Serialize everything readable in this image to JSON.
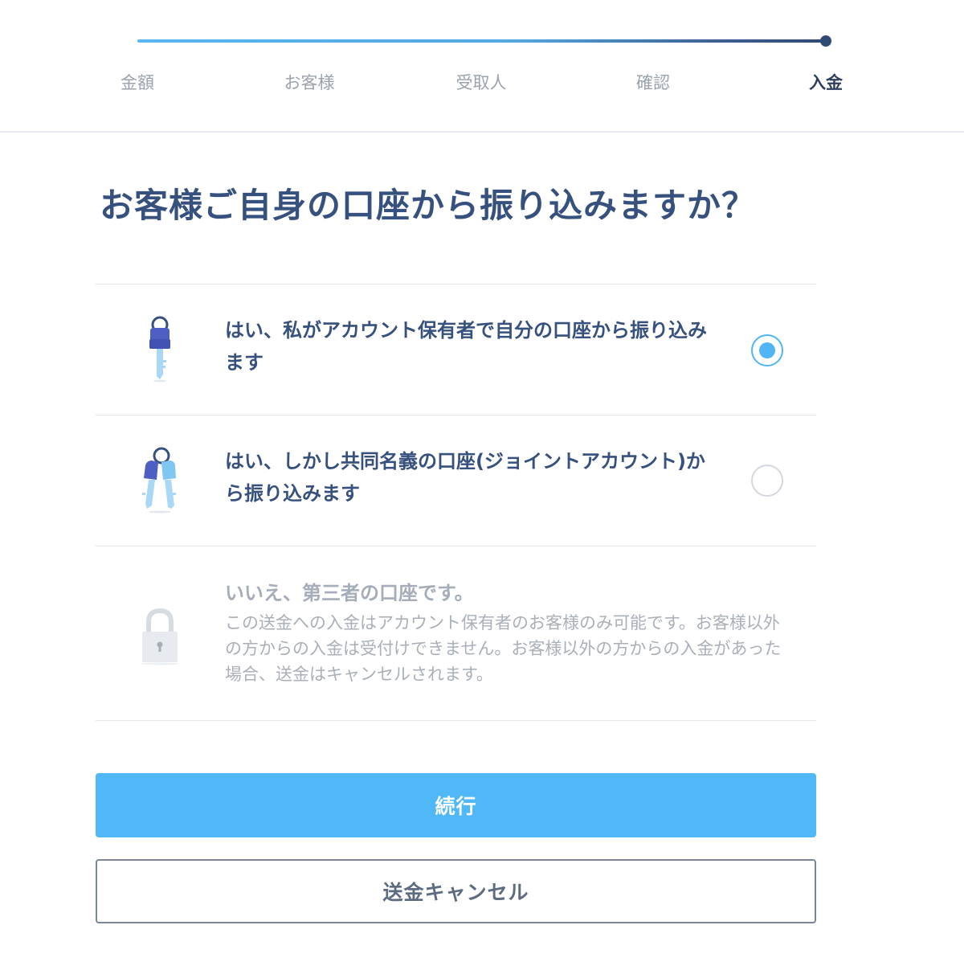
{
  "steps": [
    {
      "label": "金額"
    },
    {
      "label": "お客様"
    },
    {
      "label": "受取人"
    },
    {
      "label": "確認"
    },
    {
      "label": "入金"
    }
  ],
  "current_step": 4,
  "title": "お客様ご自身の口座から振り込みますか？",
  "options": [
    {
      "icon": "single-key-icon",
      "label": "はい、私がアカウント保有者で自分の口座から振り込みます",
      "selected": true,
      "disabled": false
    },
    {
      "icon": "two-keys-icon",
      "label": "はい、しかし共同名義の口座(ジョイントアカウント)から振り込みます",
      "selected": false,
      "disabled": false
    },
    {
      "icon": "padlock-icon",
      "label": "いいえ、第三者の口座です。",
      "description": "この送金への入金はアカウント保有者のお客様のみ可能です。お客様以外の方からの入金は受付けできません。お客様以外の方からの入金があった場合、送金はキャンセルされます。",
      "selected": false,
      "disabled": true
    }
  ],
  "buttons": {
    "continue_label": "続行",
    "cancel_label": "送金キャンセル"
  },
  "colors": {
    "primary": "#50b8f7",
    "navy": "#37517e",
    "muted": "#a4adb9"
  }
}
